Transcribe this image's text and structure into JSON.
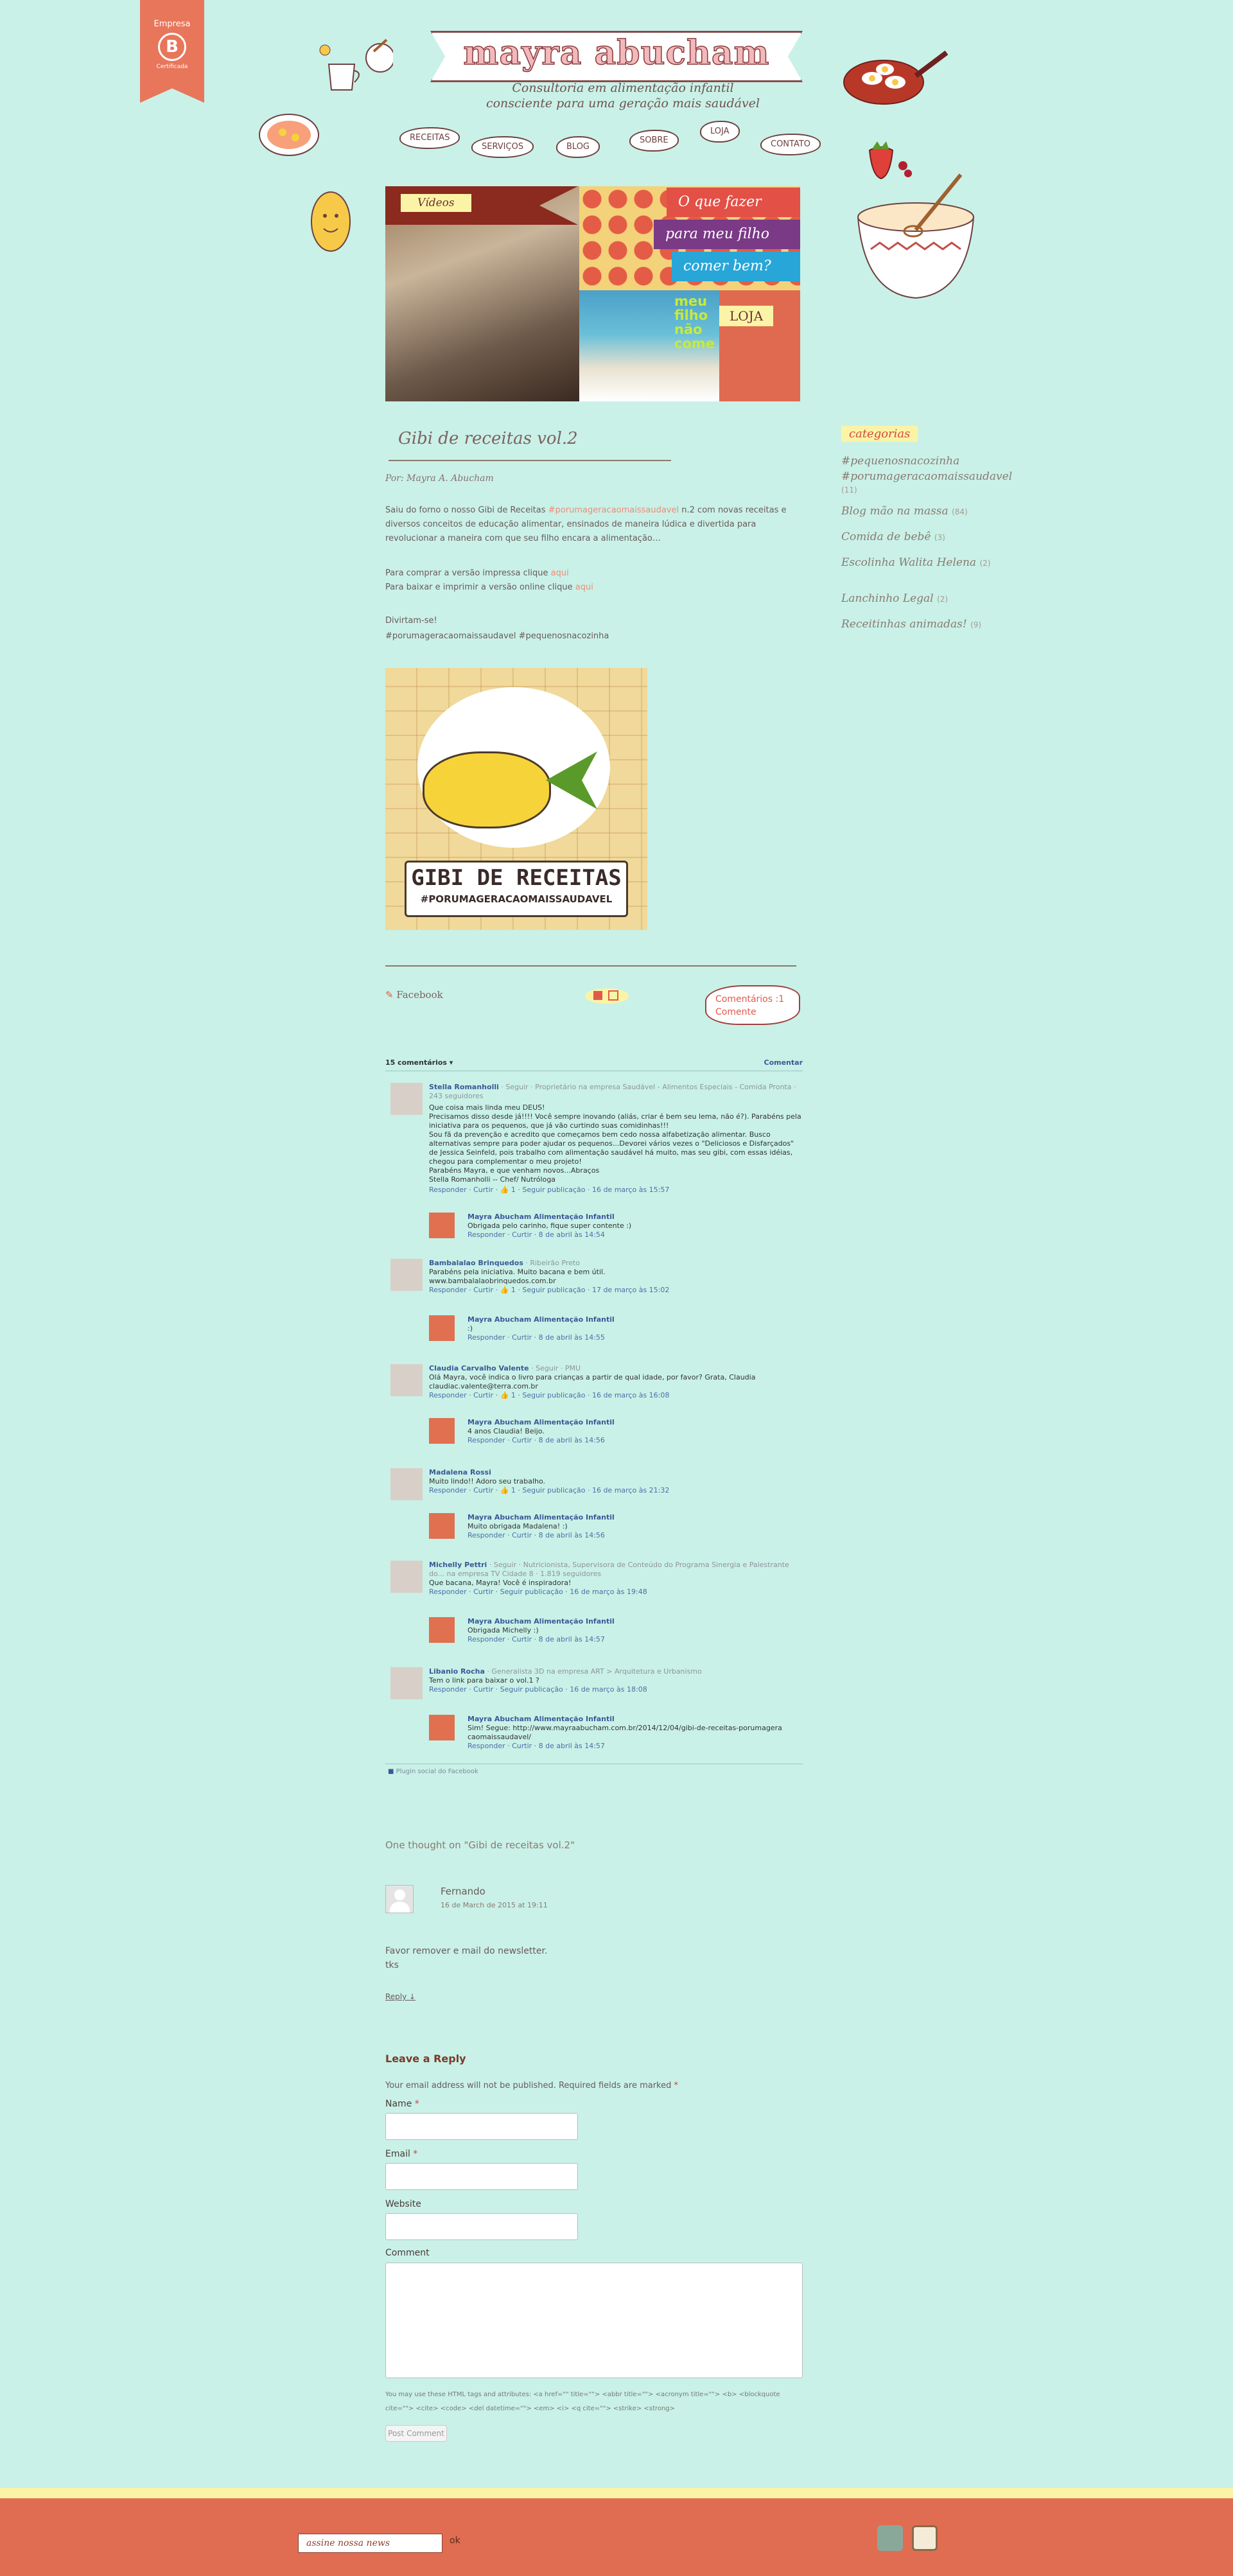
{
  "badge": {
    "line1": "Empresa",
    "logo": "B",
    "line2": "Certificada"
  },
  "header": {
    "title": "mayra abucham",
    "tagline_1": "Consultoria em alimentação infantil",
    "tagline_2": "consciente para uma geração mais saudável"
  },
  "nav": [
    {
      "label": "receitas"
    },
    {
      "label": "serviços"
    },
    {
      "label": "blog"
    },
    {
      "label": "sobre"
    },
    {
      "label": "loja"
    },
    {
      "label": "contato"
    }
  ],
  "banner": {
    "videos": "Vídeos",
    "q1": "O que fazer",
    "q2": "para meu filho",
    "q3": "comer bem?",
    "kids": "meu filho não come",
    "loja": "LOJA"
  },
  "post": {
    "title": "Gibi de receitas vol.2",
    "author": "Por: Mayra A. Abucham",
    "intro_a": "Saiu do forno o nosso Gibi de Receitas ",
    "intro_hashtag": "#porumageracaomaissaudavel",
    "intro_b": " n.2 com novas receitas e diversos conceitos de educação alimentar, ensinados de maneira lúdica e divertida para revolucionar a maneira com que seu filho encara a alimentação…",
    "buy_a": "Para comprar a versão impressa clique ",
    "buy_link": "aqui",
    "print_a": "Para baixar e imprimir a versão online clique ",
    "print_link": "aqui",
    "fun": "Divirtam-se!",
    "tags": "#porumageracaomaissaudavel #pequenosnacozinha",
    "image_title": "GIBI DE RECEITAS",
    "image_sub": "#PORUMAGERACAOMAISSAUDAVEL"
  },
  "share": {
    "facebook": "Facebook",
    "comments": "Comentários :1",
    "comment_link": "Comente"
  },
  "fb_comments": {
    "count": "15 comentários",
    "sort": "▾",
    "action": "Comentar",
    "plugin": "Plugin social do Facebook",
    "items": [
      {
        "name": "Stella Romanholli",
        "follow": "· Seguir · Proprietário na empresa Saudável - Alimentos Especiais - Comida Pronta · 243 seguidores",
        "text": "Que coisa mais linda meu DEUS!\nPrecisamos disso desde já!!!! Você sempre inovando (aliás, criar é bem seu lema, não é?). Parabéns pela iniciativa para os pequenos, que já vão curtindo suas comidinhas!!!\nSou fã da prevenção e acredito que começamos bem cedo nossa alfabetização alimentar. Busco alternativas sempre para poder ajudar os pequenos...Devorei vários vezes o \"Deliciosos e Disfarçados\" de Jessica Seinfeld, pois trabalho com alimentação saudável há muito, mas seu gibi, com essas idéias, chegou para complementar o meu projeto!\nParabéns Mayra, e que venham novos...Abraços\nStella Romanholli -- Chef/ Nutróloga",
        "meta": "Responder · Curtir · 👍 1 · Seguir publicação · 16 de março às 15:57"
      },
      {
        "name": "Mayra Abucham Alimentação Infantil",
        "text": "Obrigada pelo carinho, fique super contente :)",
        "meta": "Responder · Curtir · 8 de abril às 14:54"
      },
      {
        "name": "Bambalalao Brinquedos",
        "follow": "· Ribeirão Preto",
        "text": "Parabéns pela iniciativa. Muito bacana e bem útil.\nwww.bambalalaobrinquedos.com.br",
        "meta": "Responder · Curtir · 👍 1 · Seguir publicação · 17 de março às 15:02"
      },
      {
        "name": "Mayra Abucham Alimentação Infantil",
        "text": ":)",
        "meta": "Responder · Curtir · 8 de abril às 14:55"
      },
      {
        "name": "Claudia Carvalho Valente",
        "follow": "· Seguir · PMU",
        "text": "Olá Mayra, você indica o livro para crianças a partir de qual idade, por favor? Grata, Claudia\nclaudiac.valente@terra.com.br",
        "meta": "Responder · Curtir · 👍 1 · Seguir publicação · 16 de março às 16:08"
      },
      {
        "name": "Mayra Abucham Alimentação Infantil",
        "text": "4 anos Claudia! Beijo.",
        "meta": "Responder · Curtir · 8 de abril às 14:56"
      },
      {
        "name": "Madalena Rossi",
        "follow": "",
        "text": "Muito lindo!! Adoro seu trabalho.",
        "meta": "Responder · Curtir · 👍 1 · Seguir publicação · 16 de março às 21:32"
      },
      {
        "name": "Mayra Abucham Alimentação Infantil",
        "text": "Muito obrigada Madalena! :)",
        "meta": "Responder · Curtir · 8 de abril às 14:56"
      },
      {
        "name": "Michelly Pettri",
        "follow": "· Seguir · Nutricionista, Supervisora de Conteúdo do Programa Sinergia e Palestrante do... na empresa TV Cidade 8 · 1.819 seguidores",
        "text": "Que bacana, Mayra! Você é inspiradora!",
        "meta": "Responder · Curtir · Seguir publicação · 16 de março às 19:48"
      },
      {
        "name": "Mayra Abucham Alimentação Infantil",
        "text": "Obrigada Michelly :)",
        "meta": "Responder · Curtir · 8 de abril às 14:57"
      },
      {
        "name": "Libanio Rocha",
        "follow": "· Generalista 3D na empresa ART > Arquitetura e Urbanismo",
        "text": "Tem o link para baixar o vol.1 ?",
        "meta": "Responder · Curtir · Seguir publicação · 16 de março às 18:08"
      },
      {
        "name": "Mayra Abucham Alimentação Infantil",
        "text": "Sim! Segue: http://www.mayraabucham.com.br/2014/12/04/gibi-de-receitas-porumagera caomaissaudavel/",
        "meta": "Responder · Curtir · 8 de abril às 14:57"
      }
    ]
  },
  "wp": {
    "thought": "One thought on \"Gibi de receitas vol.2\"",
    "commenter": "Fernando",
    "date": "16 de March de 2015 at 19:11",
    "comment_1": "Favor remover e mail do newsletter.",
    "comment_2": "tks",
    "reply": "Reply ↓",
    "leave": "Leave a Reply",
    "note": "Your email address will not be published. Required fields are marked",
    "name_label": "Name",
    "email_label": "Email",
    "website_label": "Website",
    "comment_label": "Comment",
    "allowed": "You may use these HTML tags and attributes: <a href=\"\" title=\"\"> <abbr title=\"\"> <acronym title=\"\"> <b> <blockquote cite=\"\"> <cite> <code> <del datetime=\"\"> <em> <i> <q cite=\"\"> <strike> <strong>",
    "submit": "Post Comment"
  },
  "sidebar": {
    "title": "categorias",
    "items": [
      {
        "label": "#pequenosnacozinha",
        "count": ""
      },
      {
        "label": "#porumageracaomaissaudavel",
        "count": "(11)"
      },
      {
        "label": "Blog mão na massa",
        "count": "(84)"
      },
      {
        "label": "Comida de bebê",
        "count": "(3)"
      },
      {
        "label": "Escolinha Walita Helena",
        "count": "(2)"
      },
      {
        "label": "Lanchinho Legal",
        "count": "(2)"
      },
      {
        "label": "Receitinhas animadas!",
        "count": "(9)"
      }
    ]
  },
  "footer": {
    "newsletter": "assine nossa news",
    "ok": "ok"
  },
  "colors": {
    "background": "#c9f1e7",
    "accent": "#e06d52",
    "stripe": "#fbf4a6",
    "link": "#f08a7a"
  }
}
